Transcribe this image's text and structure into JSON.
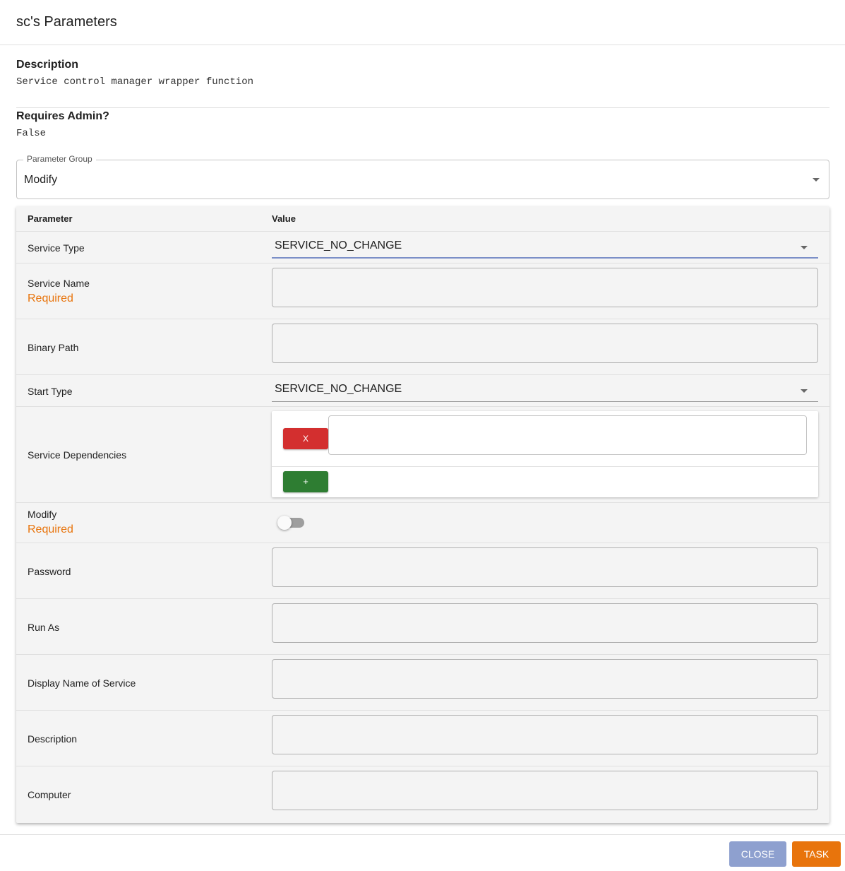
{
  "dialog": {
    "title": "sc's Parameters"
  },
  "description": {
    "heading": "Description",
    "text": "Service control manager wrapper function"
  },
  "admin": {
    "heading": "Requires Admin?",
    "value": "False"
  },
  "parameter_group": {
    "label": "Parameter Group",
    "value": "Modify"
  },
  "table": {
    "headers": {
      "parameter": "Parameter",
      "value": "Value"
    },
    "rows": [
      {
        "label": "Service Type",
        "value": "SERVICE_NO_CHANGE"
      },
      {
        "label": "Service Name",
        "required": "Required",
        "value": ""
      },
      {
        "label": "Binary Path",
        "value": ""
      },
      {
        "label": "Start Type",
        "value": "SERVICE_NO_CHANGE"
      },
      {
        "label": "Service Dependencies",
        "remove_label": "X",
        "add_label": "+",
        "value": ""
      },
      {
        "label": "Modify",
        "required": "Required",
        "checked": false
      },
      {
        "label": "Password",
        "value": ""
      },
      {
        "label": "Run As",
        "value": ""
      },
      {
        "label": "Display Name of Service",
        "value": ""
      },
      {
        "label": "Description",
        "value": ""
      },
      {
        "label": "Computer",
        "value": ""
      }
    ]
  },
  "footer": {
    "close_label": "CLOSE",
    "task_label": "TASK"
  },
  "colors": {
    "required": "#e8740c",
    "close": "#8ea0cf",
    "task": "#e8740c",
    "remove": "#d32f2f",
    "add": "#2e7d32"
  }
}
